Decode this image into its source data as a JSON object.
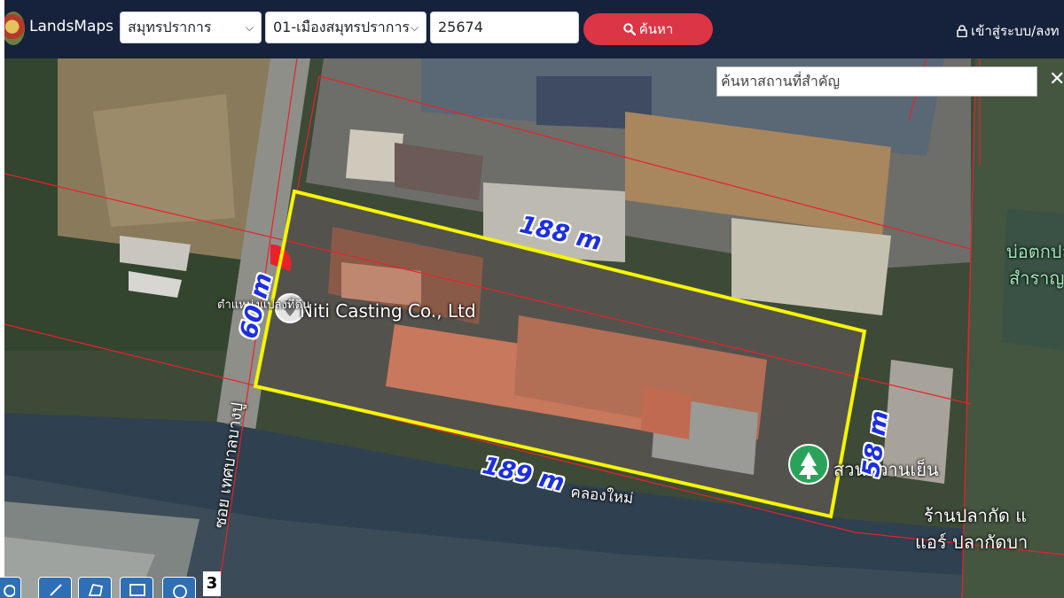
{
  "header": {
    "brand": "LandsMaps",
    "province_select": "สมุทรปราการ",
    "district_select": "01-เมืองสมุทรปราการ",
    "parcel_input": "25674",
    "search_button": "ค้นหา",
    "login_link": "เข้าสู่ระบบ/ลงท"
  },
  "map": {
    "place_search_placeholder": "ค้นหาสถานที่สำคัญ",
    "close_symbol": "✕",
    "dimension_labels": {
      "top": "188  m",
      "bottom": "189 m",
      "left": "60  m",
      "right": "58  m"
    },
    "poi": {
      "company": "Niti Casting Co., Ltd",
      "parcel_pin": "ตำแหน่งแปลงที่ดิน",
      "road": "ซอย เทศบาลบางปู",
      "park": "สวนหวานเย็น",
      "pond": "บ่อตกปลา",
      "pond_line2": "สำราญ",
      "shop": "ร้านปลากัด แ",
      "shop_line2": "แอร์ ปลากัดบา",
      "canal": "คลองใหม่"
    },
    "toolbar_count": "3"
  },
  "colors": {
    "header_bg": "#16213b",
    "search_button": "#dc3545",
    "parcel_outline": "#f5f500",
    "boundary_lines": "#e8222a",
    "label_text": "#1c2fe0",
    "toolbar": "#2e6fb5"
  }
}
